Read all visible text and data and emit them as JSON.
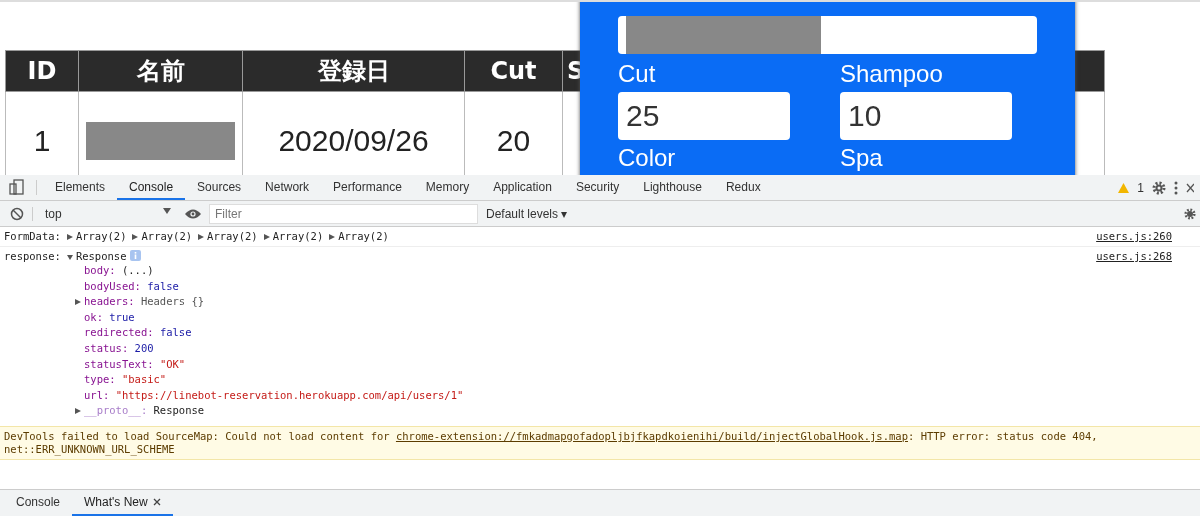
{
  "table": {
    "columns": [
      "ID",
      "名前",
      "登録日",
      "Cut",
      "S"
    ],
    "rows": [
      {
        "cells": [
          {
            "kind": "text",
            "text": "1"
          },
          {
            "kind": "redacted"
          },
          {
            "kind": "text",
            "text": "2020/09/26"
          },
          {
            "kind": "text",
            "text": "20"
          }
        ]
      }
    ]
  },
  "modal": {
    "name_field": {
      "kind": "redacted"
    },
    "fields": [
      {
        "label": "Cut",
        "value": "25"
      },
      {
        "label": "Shampoo",
        "value": "10"
      }
    ],
    "cut_labels": [
      "Color",
      "Spa"
    ]
  },
  "devtools": {
    "tabs": [
      {
        "label": "Elements",
        "selected": false
      },
      {
        "label": "Console",
        "selected": true
      },
      {
        "label": "Sources",
        "selected": false
      },
      {
        "label": "Network",
        "selected": false
      },
      {
        "label": "Performance",
        "selected": false
      },
      {
        "label": "Memory",
        "selected": false
      },
      {
        "label": "Application",
        "selected": false
      },
      {
        "label": "Security",
        "selected": false
      },
      {
        "label": "Lighthouse",
        "selected": false
      },
      {
        "label": "Redux",
        "selected": false
      }
    ],
    "warning_count": "1",
    "context": "top",
    "filter_placeholder": "Filter",
    "levels": "Default levels ▾",
    "formdata": {
      "label": "FormData:",
      "items": [
        "Array(2)",
        "Array(2)",
        "Array(2)",
        "Array(2)",
        "Array(2)"
      ],
      "source": "users.js:260"
    },
    "response": {
      "label": "response:",
      "type": "Response",
      "source": "users.js:268",
      "props": [
        {
          "key": "body:",
          "value": "(...)",
          "kind": "plain",
          "expandable": false
        },
        {
          "key": "bodyUsed:",
          "value": "false",
          "kind": "keyword",
          "expandable": false
        },
        {
          "key": "headers:",
          "value": "Headers {}",
          "kind": "object",
          "expandable": true
        },
        {
          "key": "ok:",
          "value": "true",
          "kind": "keyword",
          "expandable": false
        },
        {
          "key": "redirected:",
          "value": "false",
          "kind": "keyword",
          "expandable": false
        },
        {
          "key": "status:",
          "value": "200",
          "kind": "keyword",
          "expandable": false
        },
        {
          "key": "statusText:",
          "value": "\"OK\"",
          "kind": "string",
          "expandable": false
        },
        {
          "key": "type:",
          "value": "\"basic\"",
          "kind": "string",
          "expandable": false
        },
        {
          "key": "url:",
          "value": "\"https://linebot-reservation.herokuapp.com/api/users/1\"",
          "kind": "string",
          "expandable": false
        },
        {
          "key": "__proto__:",
          "value": "Response",
          "kind": "plain",
          "expandable": true
        }
      ]
    },
    "warning": {
      "before": "DevTools failed to load SourceMap: Could not load content for ",
      "link": "chrome-extension://fmkadmapgofadopljbjfkapdkoienihi/build/injectGlobalHook.js.map",
      "after": ": HTTP error: status code 404, net::ERR_UNKNOWN_URL_SCHEME"
    },
    "drawer_tabs": [
      {
        "label": "Console",
        "selected": false,
        "closable": false
      },
      {
        "label": "What's New",
        "selected": true,
        "closable": true
      }
    ]
  }
}
